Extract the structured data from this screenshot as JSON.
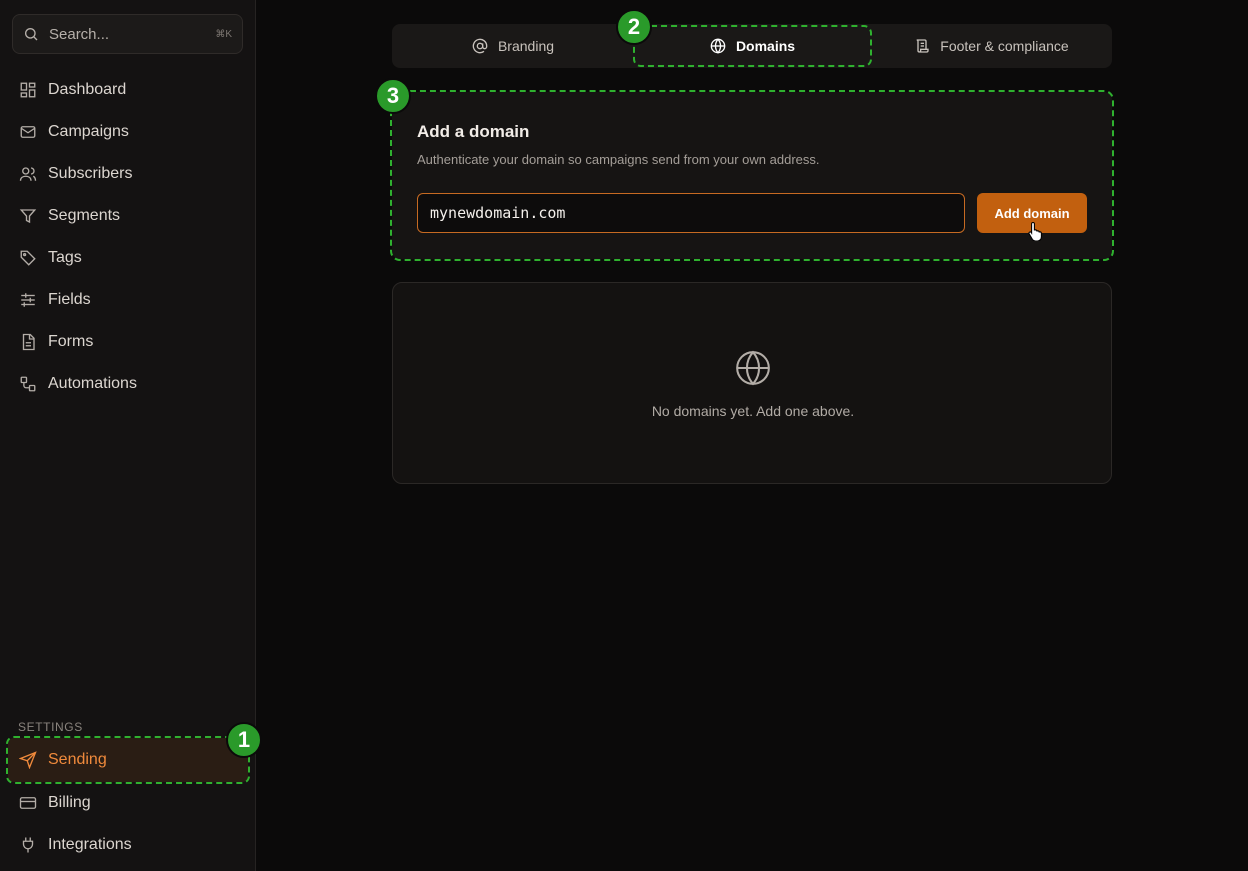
{
  "search": {
    "placeholder": "Search...",
    "shortcut": "⌘K",
    "icon": "search-icon"
  },
  "sidebar": {
    "items": [
      {
        "label": "Dashboard",
        "icon": "dashboard-icon"
      },
      {
        "label": "Campaigns",
        "icon": "mail-icon"
      },
      {
        "label": "Subscribers",
        "icon": "users-icon"
      },
      {
        "label": "Segments",
        "icon": "filter-icon"
      },
      {
        "label": "Tags",
        "icon": "tag-icon"
      },
      {
        "label": "Fields",
        "icon": "sliders-icon"
      },
      {
        "label": "Forms",
        "icon": "file-icon"
      },
      {
        "label": "Automations",
        "icon": "workflow-icon"
      }
    ],
    "settings_heading": "SETTINGS",
    "settings_items": [
      {
        "label": "Sending",
        "icon": "send-icon",
        "active": true
      },
      {
        "label": "Billing",
        "icon": "credit-card-icon"
      },
      {
        "label": "Integrations",
        "icon": "plug-icon"
      }
    ]
  },
  "tabs": [
    {
      "label": "Branding",
      "icon": "at-sign-icon"
    },
    {
      "label": "Domains",
      "icon": "globe-icon",
      "active": true
    },
    {
      "label": "Footer & compliance",
      "icon": "scroll-icon"
    }
  ],
  "add_domain": {
    "title": "Add a domain",
    "description": "Authenticate your domain so campaigns send from your own address.",
    "input_value": "mynewdomain.com",
    "button_label": "Add domain"
  },
  "empty_state": {
    "icon": "globe-icon",
    "message": "No domains yet. Add one above."
  },
  "badges": [
    "1",
    "2",
    "3"
  ],
  "colors": {
    "accent": "#f08a3c",
    "button": "#c2600f",
    "highlight": "#2fb12f"
  }
}
